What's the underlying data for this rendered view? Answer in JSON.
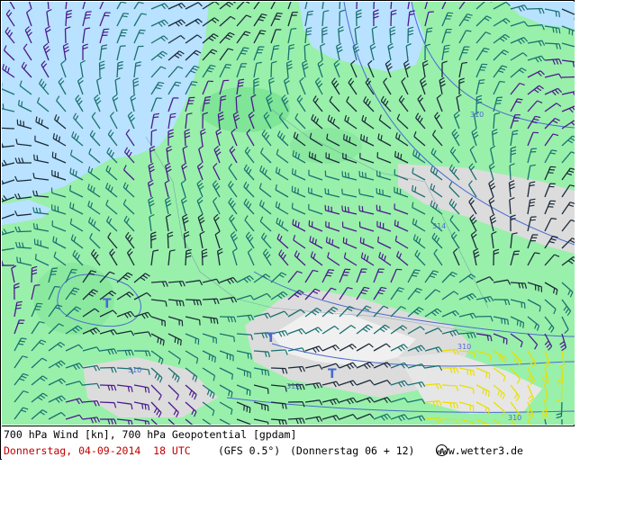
{
  "map": {
    "title_line": "700 hPa Wind [kn], 700 hPa Geopotential [gpdam]",
    "date_label": "Donnerstag, 04-09-2014  18 UTC",
    "model_label": "(GFS 0.5°)",
    "forecast_label": "(Donnerstag 06 + 12)",
    "copyright_label": "www.wetter3.de",
    "copyright_icon": "copyright-icon",
    "contour_labels": [
      "310",
      "314",
      "310",
      "312",
      "310",
      "310"
    ],
    "pressure_markers": [
      "T",
      "T",
      "T"
    ],
    "colors": {
      "sea": "#b8e2ff",
      "land": "#99f0aa",
      "land_dark": "#6ed98a",
      "mountain": "#dcdcdc",
      "barb_purple": "#4a1a8c",
      "barb_teal": "#1a7070",
      "barb_dark": "#1a2a3a",
      "barb_yellow": "#e8e000",
      "contour": "#4a6ad0",
      "date_red": "#c00000"
    }
  }
}
